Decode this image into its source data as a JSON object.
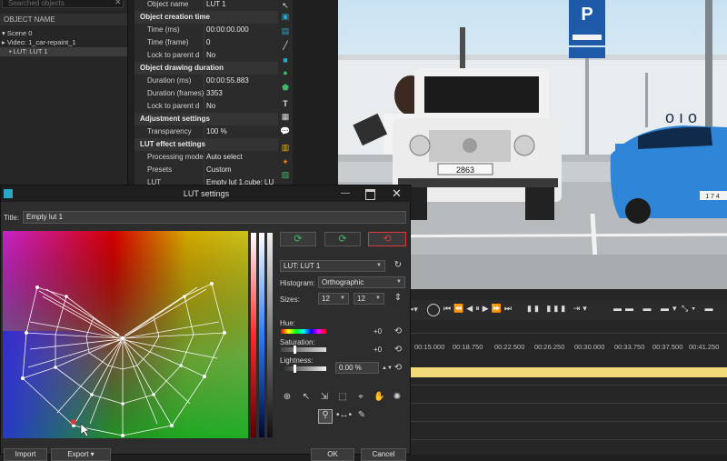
{
  "tree": {
    "search_placeholder": "Searched objects",
    "header": "OBJECT NAME",
    "items": [
      "Scene 0",
      "Video: 1_car-repaint_1",
      "LUT: LUT 1"
    ]
  },
  "props": {
    "rows": [
      {
        "key": "Object name",
        "value": "LUT 1"
      },
      {
        "section": "Object creation time"
      },
      {
        "key": "Time (ms)",
        "value": "00:00:00.000"
      },
      {
        "key": "Time (frame)",
        "value": "0"
      },
      {
        "key": "Lock to parent d",
        "value": "No"
      },
      {
        "section": "Object drawing duration"
      },
      {
        "key": "Duration (ms)",
        "value": "00:00:55.883"
      },
      {
        "key": "Duration (frames)",
        "value": "3353"
      },
      {
        "key": "Lock to parent d",
        "value": "No"
      },
      {
        "section": "Adjustment settings"
      },
      {
        "key": "Transparency",
        "value": "100 %"
      },
      {
        "section": "LUT effect settings"
      },
      {
        "key": "Processing mode",
        "value": "Auto select"
      },
      {
        "key": "Presets",
        "value": "Custom"
      },
      {
        "key": "LUT",
        "value": "Empty lut 1.cube; LU"
      }
    ]
  },
  "preview": {
    "sign": "P",
    "plate_left": "2863",
    "plate_right": "1 7 4"
  },
  "timeline": {
    "ticks": [
      "00:15.000",
      "00:18.750",
      "00:22.500",
      "00:26.250",
      "00:30.000",
      "00:33.750",
      "00:37.500",
      "00:41.250"
    ]
  },
  "dialog": {
    "title": "LUT settings",
    "title_label": "Title:",
    "title_value": "Empty lut 1",
    "lut_select": "LUT: LUT 1",
    "histogram_label": "Histogram:",
    "histogram_value": "Orthographic",
    "sizes_label": "Sizes:",
    "size_a": "12",
    "size_b": "12",
    "hue_label": "Hue:",
    "hue_value": "+0",
    "saturation_label": "Saturation:",
    "saturation_value": "+0",
    "lightness_label": "Lightness:",
    "lightness_value": "0.00 %",
    "import_label": "Import",
    "export_label": "Export",
    "ok_label": "OK",
    "cancel_label": "Cancel"
  },
  "colors": {
    "accent": "#2aa6c9",
    "timeline_bar": "#f0d978",
    "reset_red": "#d83a3a",
    "green_icon": "#3dbb6a"
  }
}
